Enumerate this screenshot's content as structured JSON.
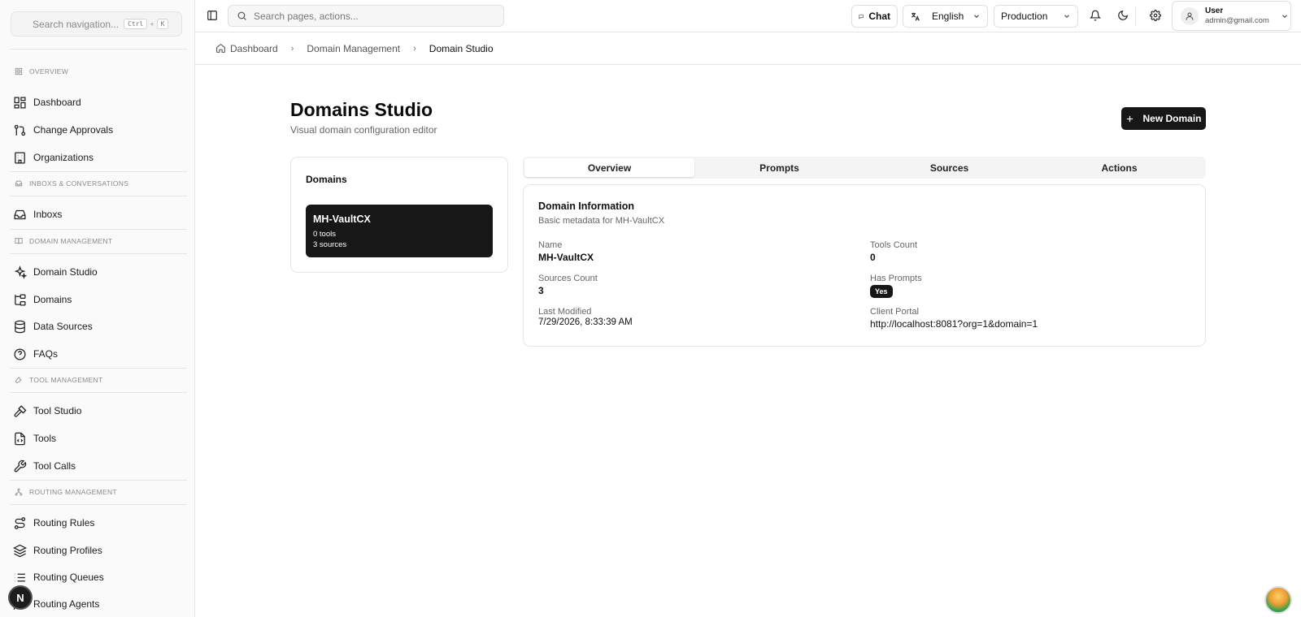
{
  "sidebar": {
    "search_placeholder": "Search navigation...",
    "shortcut_ctrl": "Ctrl",
    "shortcut_plus": "+",
    "shortcut_key": "K",
    "sections": {
      "overview": "OVERVIEW",
      "inboxes": "INBOXS & CONVERSATIONS",
      "domain": "DOMAIN MANAGEMENT",
      "tool": "TOOL MANAGEMENT",
      "routing": "ROUTING MANAGEMENT"
    },
    "items": {
      "dashboard": "Dashboard",
      "change_approvals": "Change Approvals",
      "organizations": "Organizations",
      "inboxes": "Inboxs",
      "domain_studio": "Domain Studio",
      "domains": "Domains",
      "data_sources": "Data Sources",
      "faqs": "FAQs",
      "tool_studio": "Tool Studio",
      "tools": "Tools",
      "tool_calls": "Tool Calls",
      "routing_rules": "Routing Rules",
      "routing_profiles": "Routing Profiles",
      "routing_queues": "Routing Queues",
      "routing_agents": "Routing Agents"
    },
    "avatar_letter": "N"
  },
  "topbar": {
    "search_placeholder": "Search pages, actions...",
    "chat_label": "Chat",
    "language": "English",
    "environment": "Production",
    "user_name": "User",
    "user_email": "admin@gmail.com"
  },
  "breadcrumb": {
    "home": "Dashboard",
    "parent": "Domain Management",
    "current": "Domain Studio"
  },
  "page": {
    "title": "Domains Studio",
    "subtitle": "Visual domain configuration editor",
    "new_button": "New Domain"
  },
  "domains_panel": {
    "title": "Domains",
    "items": [
      {
        "name": "MH-VaultCX",
        "tools": "0 tools",
        "sources": "3 sources"
      }
    ]
  },
  "tabs": [
    "Overview",
    "Prompts",
    "Sources",
    "Actions"
  ],
  "info": {
    "title": "Domain Information",
    "subtitle": "Basic metadata for MH-VaultCX",
    "name_label": "Name",
    "name_value": "MH-VaultCX",
    "tools_count_label": "Tools Count",
    "tools_count_value": "0",
    "sources_count_label": "Sources Count",
    "sources_count_value": "3",
    "has_prompts_label": "Has Prompts",
    "has_prompts_value": "Yes",
    "last_modified_label": "Last Modified",
    "last_modified_value": "7/29/2026, 8:33:39 AM",
    "client_portal_label": "Client Portal",
    "client_portal_value": "http://localhost:8081?org=1&domain=1"
  },
  "colors": {
    "primary": "#171717",
    "border": "#e5e5e5",
    "muted_text": "#666666"
  }
}
